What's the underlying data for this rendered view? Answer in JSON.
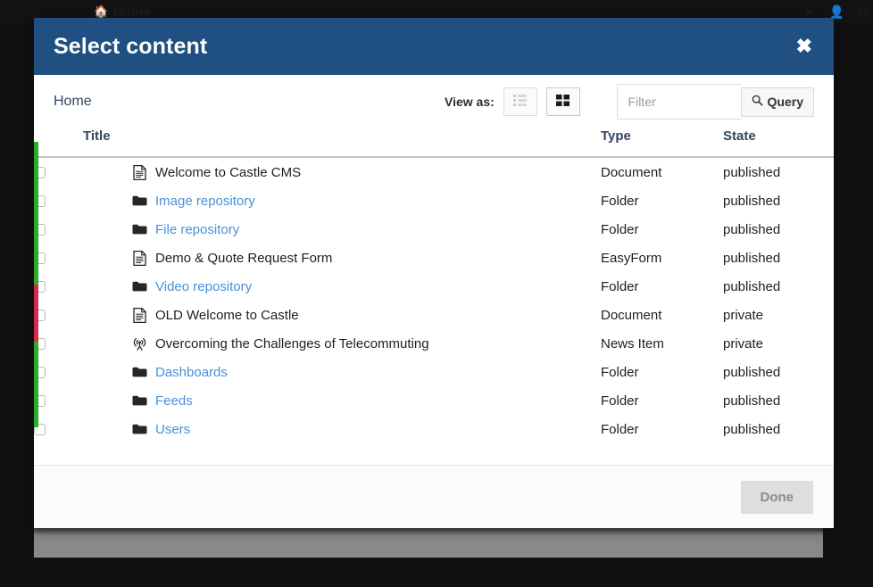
{
  "background": {
    "home_label": "Home",
    "home_icon": "home-icon",
    "right_items": [
      "star-icon",
      "user-icon",
      "N"
    ]
  },
  "modal": {
    "title": "Select content",
    "close_icon": "close-icon",
    "header_color": "#205081"
  },
  "toolbar": {
    "breadcrumb": "Home",
    "view_as_label": "View as:",
    "views": [
      {
        "name": "list-view",
        "icon": "list-icon",
        "active": false
      },
      {
        "name": "grid-view",
        "icon": "grid-icon",
        "active": true
      }
    ],
    "filter_placeholder": "Filter",
    "filter_value": "",
    "query_label": "Query",
    "query_icon": "search-icon"
  },
  "table": {
    "headers": {
      "title": "Title",
      "type": "Type",
      "state": "State"
    },
    "rows": [
      {
        "title": "Welcome to Castle CMS",
        "type": "Document",
        "state": "published",
        "icon": "document-icon",
        "is_link": false,
        "stripe": "#2aab2a"
      },
      {
        "title": "Image repository",
        "type": "Folder",
        "state": "published",
        "icon": "folder-icon",
        "is_link": true,
        "stripe": "#2aab2a"
      },
      {
        "title": "File repository",
        "type": "Folder",
        "state": "published",
        "icon": "folder-icon",
        "is_link": true,
        "stripe": "#2aab2a"
      },
      {
        "title": "Demo & Quote Request Form",
        "type": "EasyForm",
        "state": "published",
        "icon": "document-icon",
        "is_link": false,
        "stripe": "#2aab2a"
      },
      {
        "title": "Video repository",
        "type": "Folder",
        "state": "published",
        "icon": "folder-icon",
        "is_link": true,
        "stripe": "#2aab2a"
      },
      {
        "title": "OLD Welcome to Castle",
        "type": "Document",
        "state": "private",
        "icon": "document-icon",
        "is_link": false,
        "stripe": "#d6294c"
      },
      {
        "title": "Overcoming the Challenges of Telecommuting",
        "type": "News Item",
        "state": "private",
        "icon": "broadcast-icon",
        "is_link": false,
        "stripe": "#d6294c"
      },
      {
        "title": "Dashboards",
        "type": "Folder",
        "state": "published",
        "icon": "folder-icon",
        "is_link": true,
        "stripe": "#2aab2a"
      },
      {
        "title": "Feeds",
        "type": "Folder",
        "state": "published",
        "icon": "folder-icon",
        "is_link": true,
        "stripe": "#2aab2a"
      },
      {
        "title": "Users",
        "type": "Folder",
        "state": "published",
        "icon": "folder-icon",
        "is_link": true,
        "stripe": "#2aab2a"
      }
    ]
  },
  "footer": {
    "done_label": "Done"
  }
}
